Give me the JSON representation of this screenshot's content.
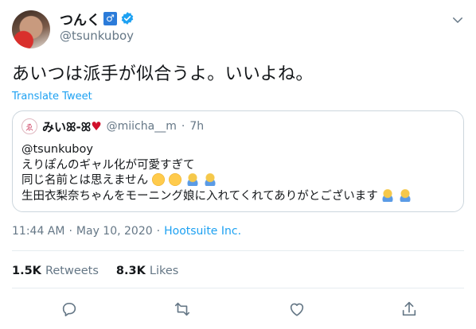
{
  "author": {
    "name": "つんく",
    "gender_badge": "♂",
    "handle": "@tsunkuboy",
    "verified": true
  },
  "tweet": {
    "text": "あいつは派手が似合うよ。いいよね。",
    "translate_label": "Translate Tweet"
  },
  "quote": {
    "avatar_glyph": "ゑ",
    "name": "みいꕤ-ꕤ",
    "heart": "♥",
    "handle": "@miicha__m",
    "separator": "·",
    "time": "7h",
    "lines": [
      "@tsunkuboy",
      "えりぽんのギャル化が可愛すぎて",
      "同じ名前とは思えません",
      "生田衣梨奈ちゃんをモーニング娘に入れてくれてありがとございます"
    ],
    "emoji_line3": [
      "sun-face",
      "sun-face",
      "bowing-person",
      "bowing-person"
    ],
    "emoji_line4": [
      "bowing-person",
      "bowing-person"
    ]
  },
  "meta": {
    "time": "11:44 AM",
    "separator1": "·",
    "date": "May 10, 2020",
    "separator2": "·",
    "source": "Hootsuite Inc."
  },
  "stats": {
    "retweets_count": "1.5K",
    "retweets_label": "Retweets",
    "likes_count": "8.3K",
    "likes_label": "Likes"
  },
  "actions": [
    "reply-icon",
    "retweet-icon",
    "like-icon",
    "share-icon"
  ],
  "colors": {
    "accent": "#1da1f2",
    "muted": "#657786",
    "text": "#14171a",
    "border": "#e6ecf0"
  }
}
